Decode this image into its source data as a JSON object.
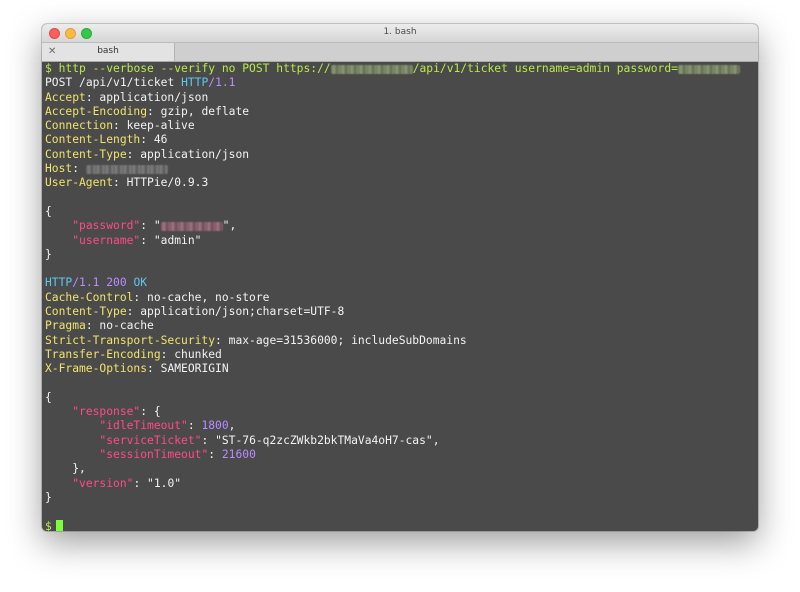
{
  "window": {
    "title": "1. bash",
    "tab": {
      "label": "bash",
      "close": "✕"
    }
  },
  "terminal": {
    "command": {
      "prompt": "$",
      "text_before": "http --verbose --verify no POST https://",
      "text_after": "/api/v1/ticket username=admin password="
    },
    "request": {
      "method": "POST",
      "path": "/api/v1/ticket",
      "protocol": "HTTP",
      "version": "/1.1",
      "headers": [
        {
          "name": "Accept",
          "value": "application/json"
        },
        {
          "name": "Accept-Encoding",
          "value": "gzip, deflate"
        },
        {
          "name": "Connection",
          "value": "keep-alive"
        },
        {
          "name": "Content-Length",
          "value": "46"
        },
        {
          "name": "Content-Type",
          "value": "application/json"
        },
        {
          "name": "Host",
          "value": ""
        },
        {
          "name": "User-Agent",
          "value": "HTTPie/0.9.3"
        }
      ],
      "body": {
        "open": "{",
        "password_key": "\"password\"",
        "username_key": "\"username\"",
        "username_value": "\"admin\"",
        "close": "}"
      }
    },
    "response": {
      "protocol": "HTTP",
      "version": "/1.1",
      "status_code": "200",
      "status_text": "OK",
      "headers": [
        {
          "name": "Cache-Control",
          "value": "no-cache, no-store"
        },
        {
          "name": "Content-Type",
          "value": "application/json;charset=UTF-8"
        },
        {
          "name": "Pragma",
          "value": "no-cache"
        },
        {
          "name": "Strict-Transport-Security",
          "value": "max-age=31536000; includeSubDomains"
        },
        {
          "name": "Transfer-Encoding",
          "value": "chunked"
        },
        {
          "name": "X-Frame-Options",
          "value": "SAMEORIGIN"
        }
      ],
      "body": {
        "open": "{",
        "response_key": "\"response\"",
        "idle_timeout_key": "\"idleTimeout\"",
        "idle_timeout_value": "1800",
        "service_ticket_key": "\"serviceTicket\"",
        "service_ticket_value": "\"ST-76-q2zcZWkb2bkTMaVa4oH7-cas\"",
        "session_timeout_key": "\"sessionTimeout\"",
        "session_timeout_value": "21600",
        "inner_close": "},",
        "version_key": "\"version\"",
        "version_value": "\"1.0\"",
        "close": "}"
      }
    },
    "prompt": "$"
  },
  "colors": {
    "background": "#4a4a4a",
    "prompt_green": "#b8ea4e",
    "header_yellow": "#f1e36b",
    "protocol_cyan": "#5ec7ef",
    "number_purple": "#b98cff",
    "json_key_pink": "#ff4a87",
    "cursor_green": "#7cff3b"
  }
}
